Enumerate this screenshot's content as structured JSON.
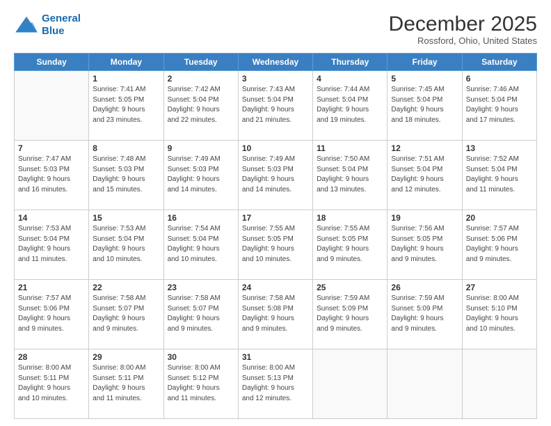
{
  "header": {
    "logo_line1": "General",
    "logo_line2": "Blue",
    "month": "December 2025",
    "location": "Rossford, Ohio, United States"
  },
  "weekdays": [
    "Sunday",
    "Monday",
    "Tuesday",
    "Wednesday",
    "Thursday",
    "Friday",
    "Saturday"
  ],
  "weeks": [
    [
      {
        "day": "",
        "detail": ""
      },
      {
        "day": "1",
        "detail": "Sunrise: 7:41 AM\nSunset: 5:05 PM\nDaylight: 9 hours\nand 23 minutes."
      },
      {
        "day": "2",
        "detail": "Sunrise: 7:42 AM\nSunset: 5:04 PM\nDaylight: 9 hours\nand 22 minutes."
      },
      {
        "day": "3",
        "detail": "Sunrise: 7:43 AM\nSunset: 5:04 PM\nDaylight: 9 hours\nand 21 minutes."
      },
      {
        "day": "4",
        "detail": "Sunrise: 7:44 AM\nSunset: 5:04 PM\nDaylight: 9 hours\nand 19 minutes."
      },
      {
        "day": "5",
        "detail": "Sunrise: 7:45 AM\nSunset: 5:04 PM\nDaylight: 9 hours\nand 18 minutes."
      },
      {
        "day": "6",
        "detail": "Sunrise: 7:46 AM\nSunset: 5:04 PM\nDaylight: 9 hours\nand 17 minutes."
      }
    ],
    [
      {
        "day": "7",
        "detail": "Sunrise: 7:47 AM\nSunset: 5:03 PM\nDaylight: 9 hours\nand 16 minutes."
      },
      {
        "day": "8",
        "detail": "Sunrise: 7:48 AM\nSunset: 5:03 PM\nDaylight: 9 hours\nand 15 minutes."
      },
      {
        "day": "9",
        "detail": "Sunrise: 7:49 AM\nSunset: 5:03 PM\nDaylight: 9 hours\nand 14 minutes."
      },
      {
        "day": "10",
        "detail": "Sunrise: 7:49 AM\nSunset: 5:03 PM\nDaylight: 9 hours\nand 14 minutes."
      },
      {
        "day": "11",
        "detail": "Sunrise: 7:50 AM\nSunset: 5:04 PM\nDaylight: 9 hours\nand 13 minutes."
      },
      {
        "day": "12",
        "detail": "Sunrise: 7:51 AM\nSunset: 5:04 PM\nDaylight: 9 hours\nand 12 minutes."
      },
      {
        "day": "13",
        "detail": "Sunrise: 7:52 AM\nSunset: 5:04 PM\nDaylight: 9 hours\nand 11 minutes."
      }
    ],
    [
      {
        "day": "14",
        "detail": "Sunrise: 7:53 AM\nSunset: 5:04 PM\nDaylight: 9 hours\nand 11 minutes."
      },
      {
        "day": "15",
        "detail": "Sunrise: 7:53 AM\nSunset: 5:04 PM\nDaylight: 9 hours\nand 10 minutes."
      },
      {
        "day": "16",
        "detail": "Sunrise: 7:54 AM\nSunset: 5:04 PM\nDaylight: 9 hours\nand 10 minutes."
      },
      {
        "day": "17",
        "detail": "Sunrise: 7:55 AM\nSunset: 5:05 PM\nDaylight: 9 hours\nand 10 minutes."
      },
      {
        "day": "18",
        "detail": "Sunrise: 7:55 AM\nSunset: 5:05 PM\nDaylight: 9 hours\nand 9 minutes."
      },
      {
        "day": "19",
        "detail": "Sunrise: 7:56 AM\nSunset: 5:05 PM\nDaylight: 9 hours\nand 9 minutes."
      },
      {
        "day": "20",
        "detail": "Sunrise: 7:57 AM\nSunset: 5:06 PM\nDaylight: 9 hours\nand 9 minutes."
      }
    ],
    [
      {
        "day": "21",
        "detail": "Sunrise: 7:57 AM\nSunset: 5:06 PM\nDaylight: 9 hours\nand 9 minutes."
      },
      {
        "day": "22",
        "detail": "Sunrise: 7:58 AM\nSunset: 5:07 PM\nDaylight: 9 hours\nand 9 minutes."
      },
      {
        "day": "23",
        "detail": "Sunrise: 7:58 AM\nSunset: 5:07 PM\nDaylight: 9 hours\nand 9 minutes."
      },
      {
        "day": "24",
        "detail": "Sunrise: 7:58 AM\nSunset: 5:08 PM\nDaylight: 9 hours\nand 9 minutes."
      },
      {
        "day": "25",
        "detail": "Sunrise: 7:59 AM\nSunset: 5:09 PM\nDaylight: 9 hours\nand 9 minutes."
      },
      {
        "day": "26",
        "detail": "Sunrise: 7:59 AM\nSunset: 5:09 PM\nDaylight: 9 hours\nand 9 minutes."
      },
      {
        "day": "27",
        "detail": "Sunrise: 8:00 AM\nSunset: 5:10 PM\nDaylight: 9 hours\nand 10 minutes."
      }
    ],
    [
      {
        "day": "28",
        "detail": "Sunrise: 8:00 AM\nSunset: 5:11 PM\nDaylight: 9 hours\nand 10 minutes."
      },
      {
        "day": "29",
        "detail": "Sunrise: 8:00 AM\nSunset: 5:11 PM\nDaylight: 9 hours\nand 11 minutes."
      },
      {
        "day": "30",
        "detail": "Sunrise: 8:00 AM\nSunset: 5:12 PM\nDaylight: 9 hours\nand 11 minutes."
      },
      {
        "day": "31",
        "detail": "Sunrise: 8:00 AM\nSunset: 5:13 PM\nDaylight: 9 hours\nand 12 minutes."
      },
      {
        "day": "",
        "detail": ""
      },
      {
        "day": "",
        "detail": ""
      },
      {
        "day": "",
        "detail": ""
      }
    ]
  ]
}
